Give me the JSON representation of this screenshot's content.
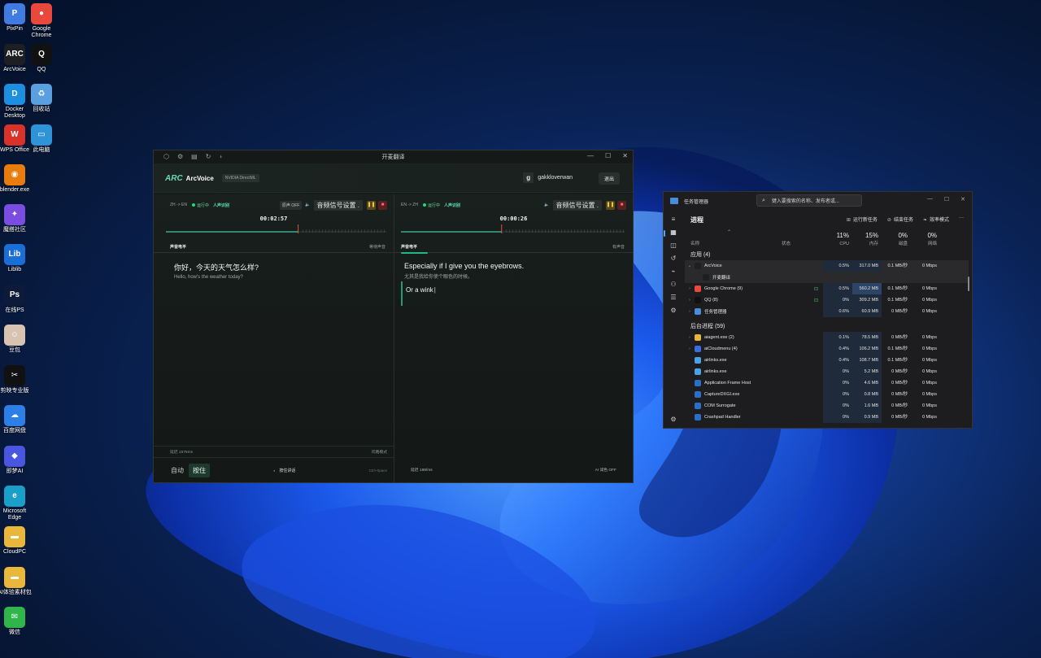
{
  "desktop": {
    "icons": [
      {
        "label": "PixPin",
        "glyph": "P",
        "color": "#3f7be0"
      },
      {
        "label": "Google Chrome",
        "glyph": "●",
        "color": "#e8493c"
      },
      {
        "label": "ArcVoice",
        "glyph": "ARC",
        "color": "#1d1f22"
      },
      {
        "label": "QQ",
        "glyph": "Q",
        "color": "#111111"
      },
      {
        "label": "Docker Desktop",
        "glyph": "D",
        "color": "#1d8fe0"
      },
      {
        "label": "回收站",
        "glyph": "♻",
        "color": "#5aa0e0"
      },
      {
        "label": "WPS Office",
        "glyph": "W",
        "color": "#d9322a"
      },
      {
        "label": "此电脑",
        "glyph": "▭",
        "color": "#2f93d8"
      },
      {
        "label": "blender.exe",
        "glyph": "◉",
        "color": "#e87d0d"
      },
      {
        "label": "魔搭社区",
        "glyph": "✦",
        "color": "#7a4de0"
      },
      {
        "label": "Liblib",
        "glyph": "Lib",
        "color": "#1a6ed8"
      },
      {
        "label": "在线PS",
        "glyph": "Ps",
        "color": "#0d1a3a"
      },
      {
        "label": "豆包",
        "glyph": "☺",
        "color": "#d8c2b0"
      },
      {
        "label": "剪映专业版",
        "glyph": "✂",
        "color": "#111111"
      },
      {
        "label": "百度网盘",
        "glyph": "☁",
        "color": "#2d7fe8"
      },
      {
        "label": "即梦AI",
        "glyph": "◆",
        "color": "#4a56e0"
      },
      {
        "label": "Microsoft Edge",
        "glyph": "e",
        "color": "#1aa0c8"
      },
      {
        "label": "CloudPC",
        "glyph": "▬",
        "color": "#e9b73a"
      },
      {
        "label": "AI体验素材包",
        "glyph": "▬",
        "color": "#e9b73a"
      },
      {
        "label": "微信",
        "glyph": "✉",
        "color": "#2fb54a"
      }
    ]
  },
  "arcvoice": {
    "window_title": "开麦翻译",
    "brand": "ArcVoice",
    "logo": "ARC",
    "badge": "NVIDIA DirectML",
    "user_initial": "g",
    "username": "gakkloverwan",
    "logout": "退出",
    "left": {
      "lang": "ZH -> EN",
      "status": "运行中",
      "voice": "人声识别",
      "chip": "原声 OFF",
      "source": "音频信号设置 .",
      "timer": "00:02:57",
      "section": "声音电平",
      "section_right": "等待声音",
      "text_src": "你好，今天的天气怎么样?",
      "text_tr": "Hello, how's the weather today?",
      "latency": "延迟 1579ms",
      "mode": "问路模式",
      "auto": "自动",
      "hold": "按住",
      "hint": "按住讲话",
      "shortcut": "Ctrl+Space",
      "level_pct": 0.6
    },
    "right": {
      "lang": "EN -> ZH",
      "status": "运行中",
      "voice": "人声识别",
      "source": "音频信号设置 .",
      "timer": "00:00:26",
      "section": "声音电平",
      "section_right": "有声音",
      "text_src": "Especially if I give you the eyebrows.",
      "text_tr": "尤其是我给你使个眼色的时候。",
      "typing": "Or a wink",
      "latency": "延迟 188/ms",
      "ai": "AI 润色 OFF",
      "level_pct": 0.45
    }
  },
  "taskmgr": {
    "title": "任务管理器",
    "search_placeholder": "键入要搜索的名称、发布者或...",
    "heading": "进程",
    "actions": [
      "运行新任务",
      "结束任务",
      "效率模式"
    ],
    "more": "···",
    "columns": {
      "name": "名称",
      "status": "状态",
      "cpu_pct": "11%",
      "cpu": "CPU",
      "mem_pct": "15%",
      "mem": "内存",
      "disk_pct": "0%",
      "disk": "磁盘",
      "net_pct": "0%",
      "net": "网络"
    },
    "apps_group": "应用 (4)",
    "bg_group": "后台进程 (59)",
    "apps": [
      {
        "name": "ArcVoice",
        "cpu": "0.5%",
        "mem": "317.0 MB",
        "disk": "0.1 MB/秒",
        "net": "0 Mbps",
        "expanded": true,
        "color": "#1d1f22",
        "child": "开麦翻译"
      },
      {
        "name": "Google Chrome (9)",
        "cpu": "0.5%",
        "mem": "560.2 MB",
        "disk": "0.1 MB/秒",
        "net": "0 Mbps",
        "status": "⊡",
        "color": "#e8493c"
      },
      {
        "name": "QQ (8)",
        "cpu": "0%",
        "mem": "309.2 MB",
        "disk": "0.1 MB/秒",
        "net": "0 Mbps",
        "status": "⊡",
        "color": "#111111"
      },
      {
        "name": "任务管理器",
        "cpu": "0.6%",
        "mem": "60.9 MB",
        "disk": "0 MB/秒",
        "net": "0 Mbps",
        "color": "#4a8cd9"
      }
    ],
    "bg": [
      {
        "name": "aiagent.exe (2)",
        "cpu": "0.1%",
        "mem": "78.5 MB",
        "disk": "0 MB/秒",
        "net": "0 Mbps",
        "chev": true,
        "color": "#e7b53a"
      },
      {
        "name": "aiCloudmenu (4)",
        "cpu": "0.4%",
        "mem": "106.2 MB",
        "disk": "0.1 MB/秒",
        "net": "0 Mbps",
        "chev": true,
        "color": "#3b6de0"
      },
      {
        "name": "airlinks.exe",
        "cpu": "0.4%",
        "mem": "108.7 MB",
        "disk": "0.1 MB/秒",
        "net": "0 Mbps",
        "color": "#4aa3e8"
      },
      {
        "name": "airlinks.exe",
        "cpu": "0%",
        "mem": "5.2 MB",
        "disk": "0 MB/秒",
        "net": "0 Mbps",
        "color": "#4aa3e8"
      },
      {
        "name": "Application Frame Host",
        "cpu": "0%",
        "mem": "4.6 MB",
        "disk": "0 MB/秒",
        "net": "0 Mbps",
        "color": "#2b6fc8"
      },
      {
        "name": "CaptureDXGI.exe",
        "cpu": "0%",
        "mem": "0.8 MB",
        "disk": "0 MB/秒",
        "net": "0 Mbps",
        "color": "#2b6fc8"
      },
      {
        "name": "COM Surrogate",
        "cpu": "0%",
        "mem": "1.6 MB",
        "disk": "0 MB/秒",
        "net": "0 Mbps",
        "color": "#2b6fc8"
      },
      {
        "name": "Crashpad Handler",
        "cpu": "0%",
        "mem": "0.9 MB",
        "disk": "0 MB/秒",
        "net": "0 Mbps",
        "color": "#2b6fc8"
      }
    ]
  }
}
